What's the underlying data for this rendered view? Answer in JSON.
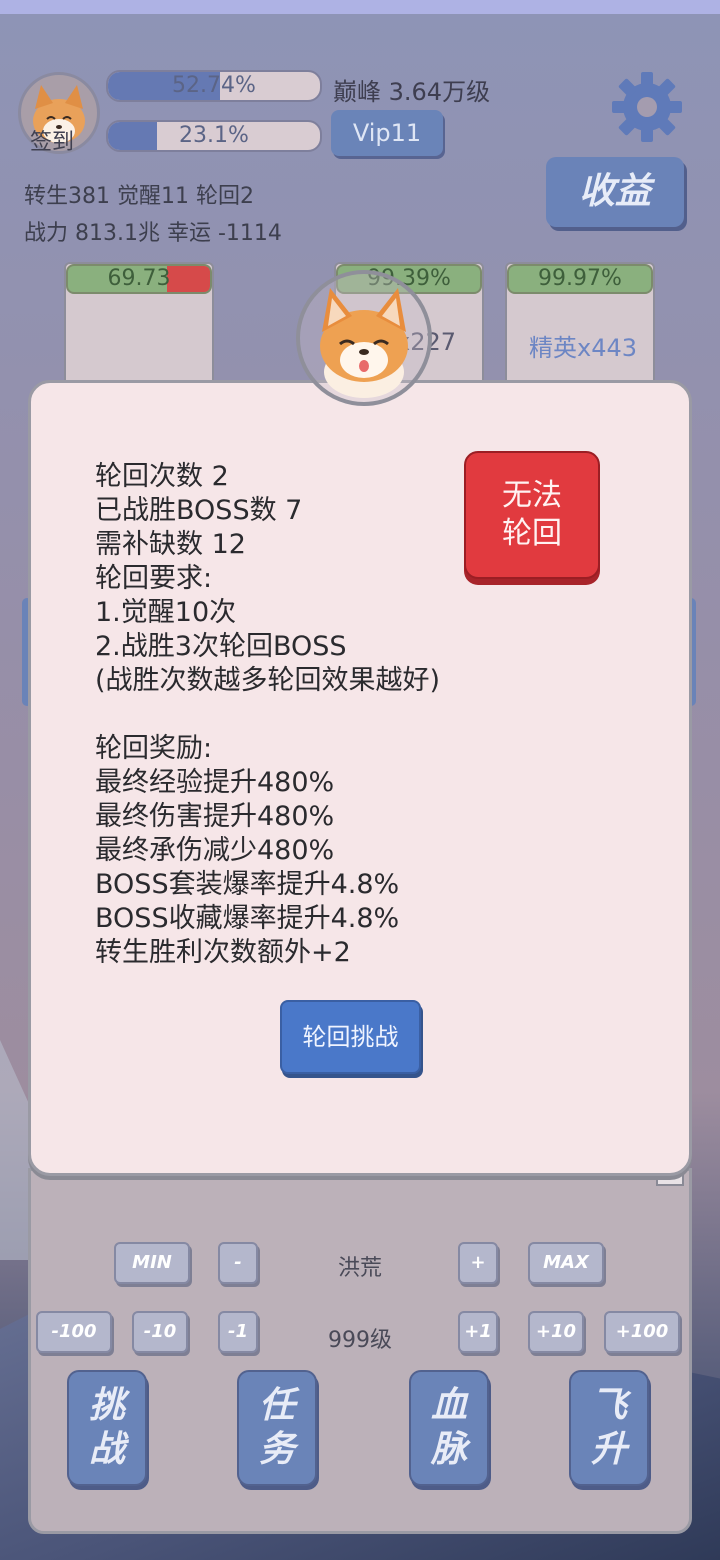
{
  "header": {
    "signin_label": "签到",
    "exp_bar": {
      "text": "52.74%",
      "progress": 0.5274
    },
    "second_bar": {
      "text": "23.1%",
      "progress": 0.231
    },
    "peak_text": "巅峰 3.64万级",
    "vip_label": "Vip11",
    "income_label": "收益",
    "stats_line1": "转生381 觉醒11 轮回2",
    "stats_line2": "战力 813.1兆  幸运 -1114"
  },
  "cards": [
    {
      "bar_text": "69.73",
      "progress": 0.6973,
      "label": ""
    },
    {
      "bar_text": "99.39%",
      "progress": 0.9939,
      "label": "x227"
    },
    {
      "bar_text": "99.97%",
      "progress": 0.9997,
      "label": "精英x443"
    }
  ],
  "modal": {
    "lines": [
      "轮回次数 2",
      "已战胜BOSS数 7",
      "需补缺数 12",
      "轮回要求:",
      "1.觉醒10次",
      "2.战胜3次轮回BOSS",
      "(战胜次数越多轮回效果越好)",
      "",
      "轮回奖励:",
      "最终经验提升480%",
      "最终伤害提升480%",
      "最终承伤减少480%",
      "BOSS套装爆率提升4.8%",
      "BOSS收藏爆率提升4.8%",
      "转生胜利次数额外+2"
    ],
    "cannot_label_1": "无法",
    "cannot_label_2": "轮回",
    "challenge_label": "轮回挑战"
  },
  "controls": {
    "row1": {
      "min": "MIN",
      "minus": "-",
      "center": "洪荒",
      "plus": "+",
      "max": "MAX"
    },
    "row2": {
      "m100": "-100",
      "m10": "-10",
      "m1": "-1",
      "center": "999级",
      "p1": "+1",
      "p10": "+10",
      "p100": "+100"
    },
    "actions": [
      {
        "top": "挑",
        "bottom": "战"
      },
      {
        "top": "任",
        "bottom": "务"
      },
      {
        "top": "血",
        "bottom": "脉"
      },
      {
        "top": "飞",
        "bottom": "升"
      }
    ]
  },
  "colors": {
    "accent_blue": "#6a84b8",
    "danger_red": "#e13a3f",
    "panel_bg": "#f6e6e8"
  }
}
